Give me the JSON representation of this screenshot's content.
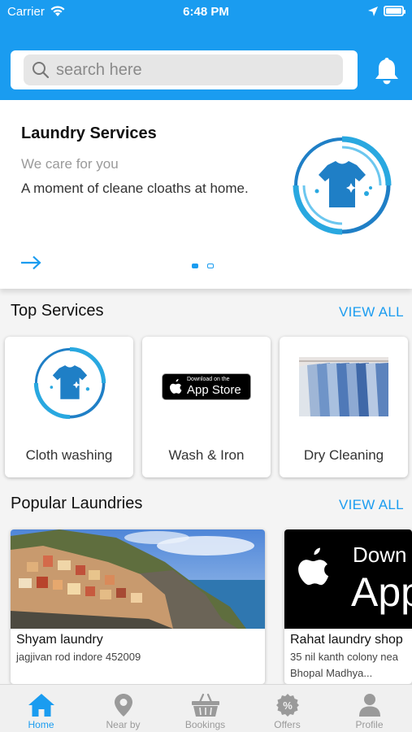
{
  "status_bar": {
    "carrier": "Carrier",
    "time": "6:48 PM"
  },
  "search": {
    "placeholder": "search here"
  },
  "banner": {
    "title": "Laundry Services",
    "subtitle": "We care for you",
    "description": "A moment of cleane cloaths at home.",
    "active_slide": 1,
    "slide_count": 2
  },
  "top_services": {
    "title": "Top Services",
    "view_all": "VIEW ALL",
    "items": [
      {
        "label": "Cloth washing",
        "icon": "laundry-logo"
      },
      {
        "label": "Wash & Iron",
        "icon": "app-store-badge",
        "badge_small": "Download on the",
        "badge_big": "App Store"
      },
      {
        "label": "Dry Cleaning",
        "icon": "hanging-shirts-photo"
      }
    ]
  },
  "popular_laundries": {
    "title": "Popular Laundries",
    "view_all": "VIEW ALL",
    "items": [
      {
        "name": "Shyam laundry",
        "address": "jagjivan rod indore 452009",
        "address2": ""
      },
      {
        "name": "Rahat laundry shop",
        "address": "35 nil kanth colony nea",
        "address2": "Bhopal Madhya...",
        "image_text": "Down",
        "image_text2": "App"
      }
    ]
  },
  "tabs": [
    {
      "label": "Home",
      "icon": "home-icon",
      "active": true
    },
    {
      "label": "Near by",
      "icon": "location-pin-icon",
      "active": false
    },
    {
      "label": "Bookings",
      "icon": "basket-icon",
      "active": false
    },
    {
      "label": "Offers",
      "icon": "percent-badge-icon",
      "active": false
    },
    {
      "label": "Profile",
      "icon": "person-icon",
      "active": false
    }
  ],
  "colors": {
    "primary": "#1a9cf0",
    "inactive": "#9a9a9a",
    "background": "#f4f4f4"
  }
}
